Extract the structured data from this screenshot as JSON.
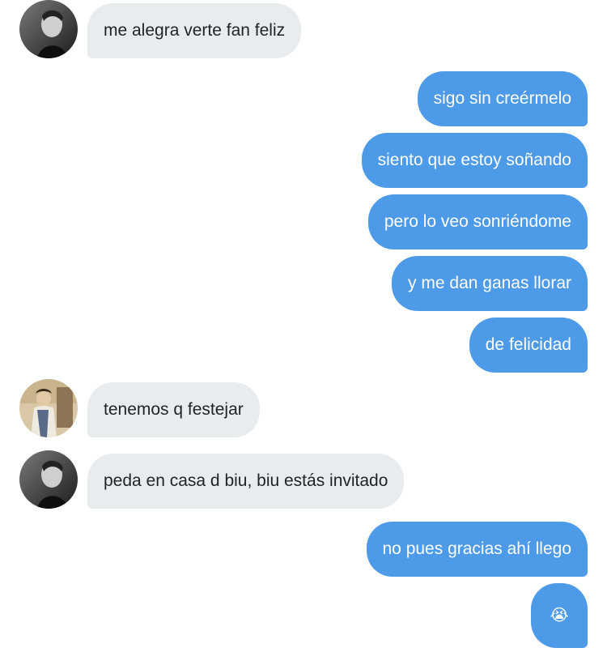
{
  "conversation": {
    "messages": [
      {
        "sender": "other",
        "text": "me alegra verte fan feliz"
      },
      {
        "sender": "me",
        "text": "sigo sin creérmelo"
      },
      {
        "sender": "me",
        "text": "siento que estoy soñando"
      },
      {
        "sender": "me",
        "text": "pero lo veo sonriéndome"
      },
      {
        "sender": "me",
        "text": "y me dan ganas llorar"
      },
      {
        "sender": "me",
        "text": "de felicidad"
      },
      {
        "sender": "other",
        "text": "tenemos q festejar"
      },
      {
        "sender": "other",
        "text": "peda en casa d biu, biu estás invitado"
      },
      {
        "sender": "me",
        "text": "no pues gracias ahí llego"
      },
      {
        "sender": "me",
        "text": "😭"
      }
    ]
  },
  "colors": {
    "incoming_bubble": "#e9ecef",
    "outgoing_bubble": "#4d9be8",
    "incoming_text": "#1f2328",
    "outgoing_text": "#ffffff"
  }
}
